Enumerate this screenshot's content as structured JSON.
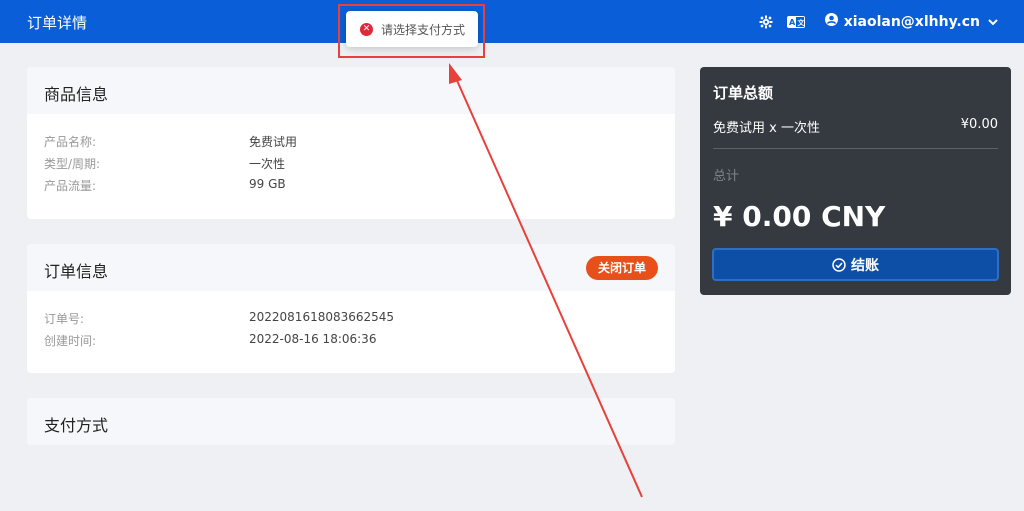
{
  "header": {
    "title": "订单详情",
    "account_email": "xiaolan@xlhhy.cn",
    "icons": [
      "gear-icon",
      "translate-icon",
      "user-icon",
      "chevron-down-icon"
    ]
  },
  "toast": {
    "message": "请选择支付方式",
    "icon": "error-icon"
  },
  "product_card": {
    "title": "商品信息",
    "rows": [
      {
        "label": "产品名称:",
        "value": "免费试用"
      },
      {
        "label": "类型/周期:",
        "value": "一次性"
      },
      {
        "label": "产品流量:",
        "value": "99 GB"
      }
    ]
  },
  "order_card": {
    "title": "订单信息",
    "close_label": "关闭订单",
    "rows": [
      {
        "label": "订单号:",
        "value": "2022081618083662545"
      },
      {
        "label": "创建时间:",
        "value": "2022-08-16 18:06:36"
      }
    ]
  },
  "payment_card": {
    "title": "支付方式"
  },
  "summary": {
    "title": "订单总额",
    "line_item": "免费试用 x 一次性",
    "line_price": "¥0.00",
    "total_label": "总计",
    "total": "¥ 0.00 CNY",
    "checkout_label": "结账"
  },
  "colors": {
    "header": "#0a5ed7",
    "close_button": "#e8501b",
    "summary_bg": "#343a40",
    "checkout": "#0d4fa6",
    "annotation": "#e8403a"
  }
}
